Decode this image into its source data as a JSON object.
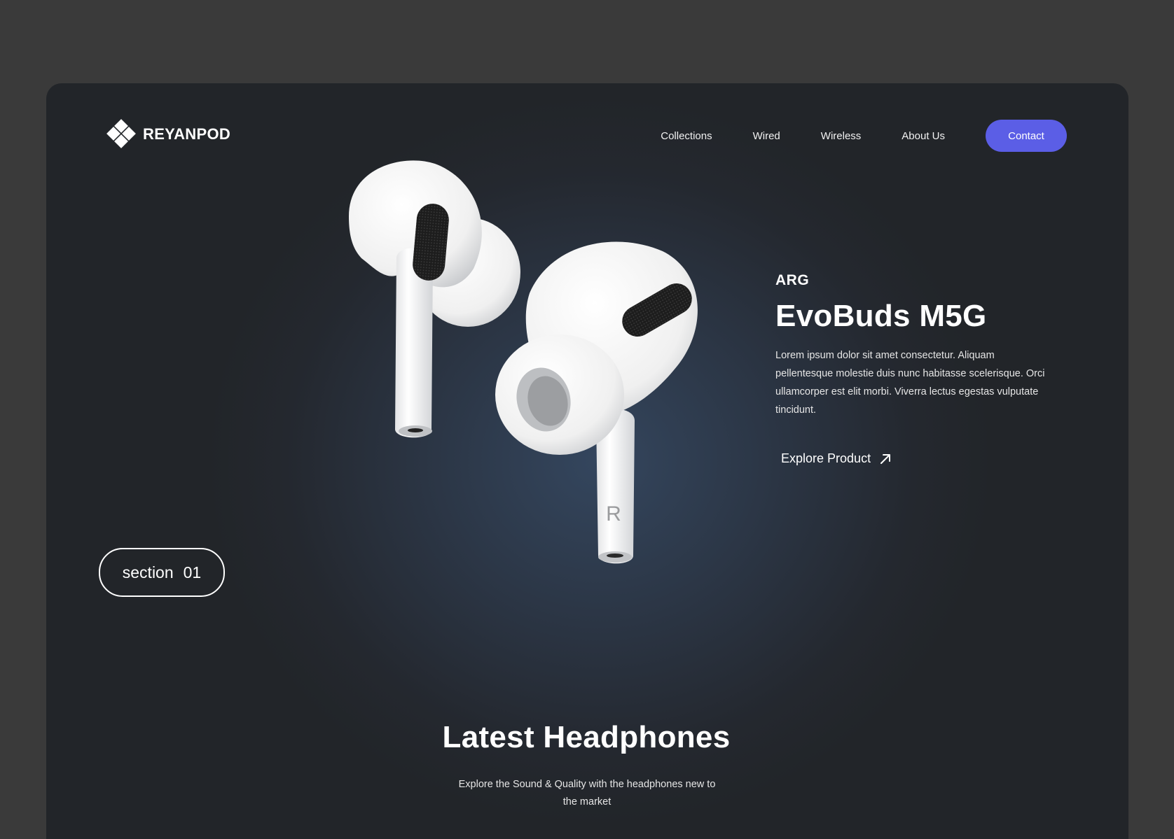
{
  "brand": {
    "name": "REYANPOD",
    "logo_icon": "diamond-grid-icon"
  },
  "nav": {
    "items": [
      "Collections",
      "Wired",
      "Wireless",
      "About Us"
    ],
    "cta": "Contact",
    "accent_color": "#5b5ee6"
  },
  "hero": {
    "brand": "ARG",
    "title": "EvoBuds M5G",
    "description": "Lorem ipsum dolor sit amet consectetur. Aliquam pellentesque molestie duis nunc habitasse scelerisque. Orci ullamcorper est elit morbi. Viverra lectus egestas vulputate tincidunt.",
    "cta": "Explore Product",
    "cta_icon": "arrow-up-right-icon",
    "earbud_mark": "R"
  },
  "section": {
    "label": "section",
    "number": "01"
  },
  "latest": {
    "title": "Latest Headphones",
    "subtitle": "Explore the Sound & Quality with the headphones new to the market"
  }
}
